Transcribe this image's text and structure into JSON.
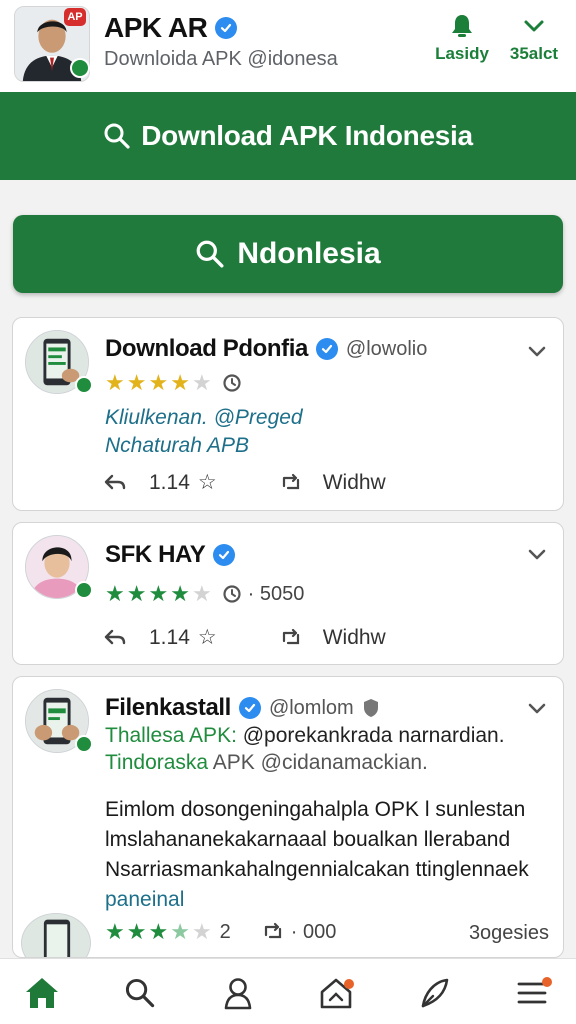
{
  "header": {
    "app_name": "APK AR",
    "subtitle": "Downloida APK @idonesa",
    "badge": "AP",
    "action_left_label": "Lasidy",
    "action_right_label": "35alct"
  },
  "banner": {
    "text": "Download APK Indonesia"
  },
  "search_button": {
    "label": "Ndonlesia"
  },
  "cards": [
    {
      "title": "Download Pdonfia",
      "handle": "@lowolio",
      "rating": 4,
      "line1": "Kliulkenan. @Preged",
      "line2": "Nchaturah APB",
      "reply_count": "1.14",
      "share_label": "Widhw"
    },
    {
      "title": "SFK HAY",
      "rating": 4,
      "meta": "· 5050",
      "reply_count": "1.14",
      "share_label": "Widhw"
    },
    {
      "title": "Filenkastall",
      "handle": "@lomlom",
      "line1_a": "Thallesa APK:",
      "line1_b": " @porekankrada narnardian.",
      "line2_a": "Tindoraska",
      "line2_b": " APK @cidanamackian.",
      "body_lines": [
        "Eimlom dosongeningahalpla OPK l sunlestan",
        "lmslahananekakarnaaal boualkan lleraband",
        "Nsarriasmankahalngennialcakan ttinglennaek"
      ],
      "body_link": "paneinal",
      "rating": 3.5,
      "rating_count": "2",
      "repost_meta": "· 000",
      "right_meta": "3ogesies"
    }
  ],
  "colors": {
    "brand_green": "#207a3b",
    "verified_blue": "#2d8cf0",
    "star_gold": "#e3b31c",
    "star_green": "#1f8c3e",
    "link_teal": "#1d6f8a",
    "notif_orange": "#e8632a"
  },
  "nav": {
    "items": [
      "home-icon",
      "search-icon",
      "profile-icon",
      "inbox-icon",
      "feather-icon",
      "menu-icon"
    ]
  }
}
